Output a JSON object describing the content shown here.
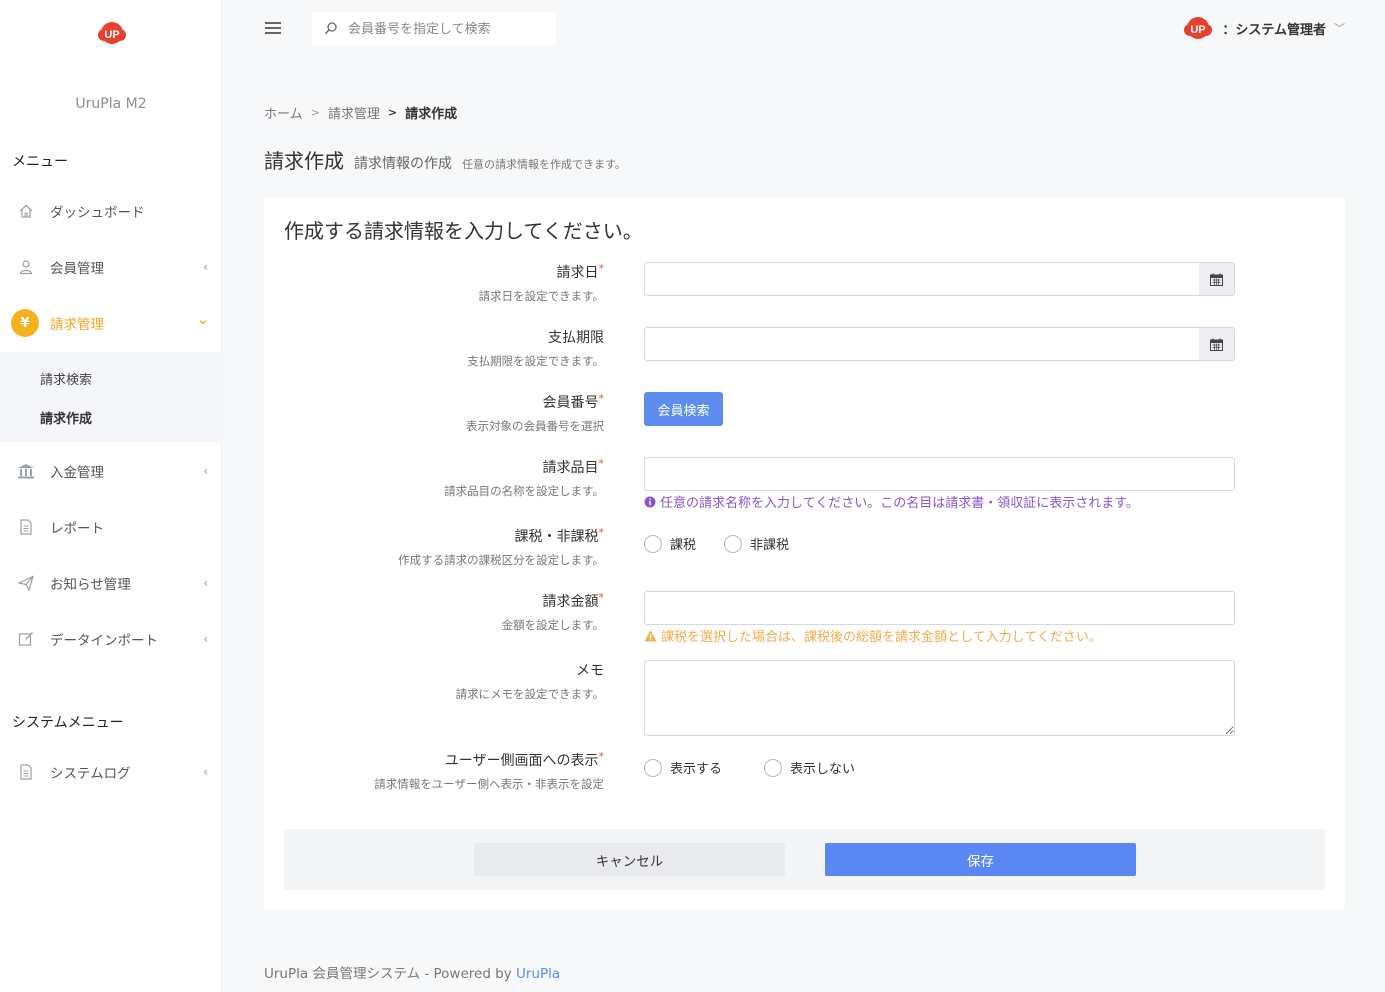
{
  "sidebar": {
    "brand": "UruPla M2",
    "menu_heading": "メニュー",
    "items": [
      {
        "label": "ダッシュボード",
        "icon": "home-icon"
      },
      {
        "label": "会員管理",
        "icon": "user-icon",
        "arrow": "‹"
      },
      {
        "label": "請求管理",
        "icon": "yen-icon",
        "arrow": "›"
      },
      {
        "label": "入金管理",
        "icon": "bank-icon",
        "arrow": "‹"
      },
      {
        "label": "レポート",
        "icon": "document-icon"
      },
      {
        "label": "お知らせ管理",
        "icon": "paper-plane-icon",
        "arrow": "‹"
      },
      {
        "label": "データインポート",
        "icon": "edit-icon",
        "arrow": "‹"
      }
    ],
    "sub_items": [
      "請求検索",
      "請求作成"
    ],
    "system_heading": "システムメニュー",
    "system_items": [
      {
        "label": "システムログ",
        "icon": "log-icon",
        "arrow": "‹"
      }
    ],
    "yen_symbol": "¥"
  },
  "topbar": {
    "search_placeholder": "会員番号を指定して検索",
    "user_name": "：システム管理者",
    "user_chevron": "﹀"
  },
  "breadcrumb": {
    "items": [
      "ホーム",
      "請求管理",
      "請求作成"
    ],
    "separator": ">"
  },
  "page": {
    "title": "請求作成",
    "subtitle": "請求情報の作成",
    "description": "任意の請求情報を作成できます。"
  },
  "form": {
    "heading": "作成する請求情報を入力してください。",
    "required_mark": "*",
    "fields": {
      "invoice_date": {
        "label": "請求日",
        "help": "請求日を設定できます。",
        "value": ""
      },
      "due_date": {
        "label": "支払期限",
        "help": "支払期限を設定できます。",
        "value": ""
      },
      "member_number": {
        "label": "会員番号",
        "help": "表示対象の会員番号を選択",
        "button": "会員検索"
      },
      "item_name": {
        "label": "請求品目",
        "help": "請求品目の名称を設定します。",
        "value": "",
        "hint": "任意の請求名称を入力してください。この名目は請求書・領収証に表示されます。"
      },
      "tax": {
        "label": "課税・非課税",
        "help": "作成する請求の課税区分を設定します。",
        "options": [
          "課税",
          "非課税"
        ]
      },
      "amount": {
        "label": "請求金額",
        "help": "金額を設定します。",
        "value": "",
        "hint": "課税を選択した場合は、課税後の総額を請求金額として入力してください。"
      },
      "memo": {
        "label": "メモ",
        "help": "請求にメモを設定できます。",
        "value": ""
      },
      "visibility": {
        "label": "ユーザー側画面への表示",
        "help": "請求情報をユーザー側へ表示・非表示を設定",
        "options": [
          "表示する",
          "表示しない"
        ]
      }
    },
    "cancel_label": "キャンセル",
    "save_label": "保存"
  },
  "footer": {
    "text": "UruPla 会員管理システム - Powered by ",
    "link": "UruPla"
  },
  "colors": {
    "accent_orange": "#f5a623",
    "primary_blue": "#5b87f5",
    "info_purple": "#8a55c9",
    "warn_orange": "#f0ad4e",
    "logo_red": "#e8402f"
  }
}
